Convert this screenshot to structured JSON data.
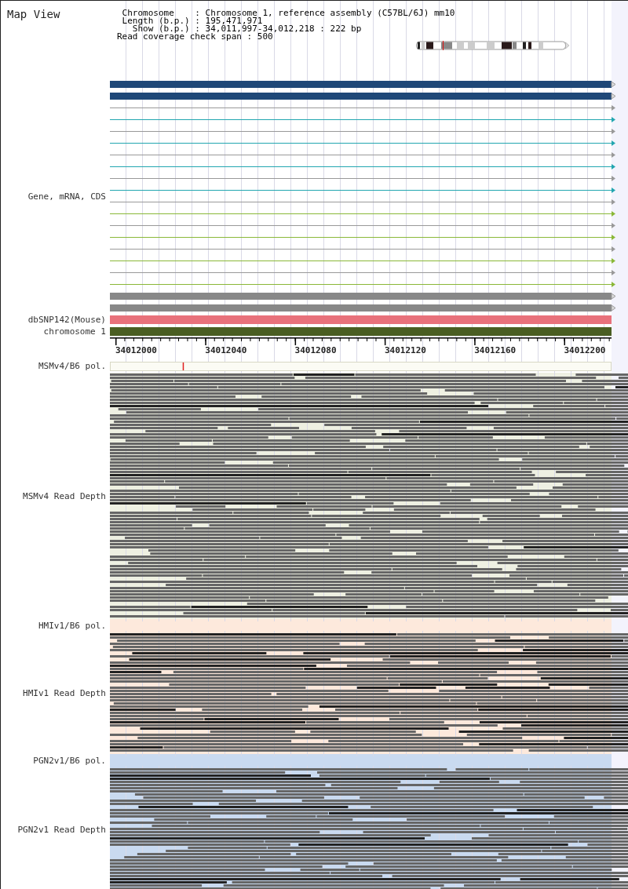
{
  "title": "Map View",
  "info_lines": [
    " Chromosome    : Chromosome 1, reference assembly (C57BL/6J) mm10",
    " Length (b.p.) : 195,471,971",
    "   Show (b.p.) : 34,011,997-34,012,218 : 222 bp",
    "Read coverage check span : 500"
  ],
  "gene_track": {
    "label": "Gene, mRNA, CDS",
    "rows": [
      {
        "kind": "thick",
        "color": "#1f4878"
      },
      {
        "kind": "thick",
        "color": "#1f4878"
      },
      {
        "kind": "thin",
        "color": "#999999"
      },
      {
        "kind": "thin",
        "color": "#22a6b0"
      },
      {
        "kind": "thin",
        "color": "#999999"
      },
      {
        "kind": "thin",
        "color": "#22a6b0"
      },
      {
        "kind": "thin",
        "color": "#999999"
      },
      {
        "kind": "thin",
        "color": "#22a6b0"
      },
      {
        "kind": "thin",
        "color": "#999999"
      },
      {
        "kind": "thin",
        "color": "#22a6b0"
      },
      {
        "kind": "thin",
        "color": "#999999"
      },
      {
        "kind": "thin",
        "color": "#8ab838"
      },
      {
        "kind": "thin",
        "color": "#999999"
      },
      {
        "kind": "thin",
        "color": "#8ab838"
      },
      {
        "kind": "thin",
        "color": "#999999"
      },
      {
        "kind": "thin",
        "color": "#8ab838"
      },
      {
        "kind": "thin",
        "color": "#999999"
      },
      {
        "kind": "thin",
        "color": "#8ab838"
      },
      {
        "kind": "thick",
        "color": "#888888"
      },
      {
        "kind": "thick",
        "color": "#888888"
      }
    ]
  },
  "feature_tracks": [
    {
      "label": "dbSNP142(Mouse)",
      "color": "#e8717b"
    },
    {
      "label": "chromosome 1",
      "color": "#4a5e22"
    }
  ],
  "axis": {
    "ticks": [
      "34012000",
      "34012040",
      "34012080",
      "34012120",
      "34012160",
      "34012200"
    ]
  },
  "sample_tracks": [
    {
      "pol_label": "MSMv4/B6 pol.",
      "depth_label": "MSMv4 Read Depth",
      "color": "#eef0e2",
      "variant_marked": true
    },
    {
      "pol_label": "HMIv1/B6 pol.",
      "depth_label": "HMIv1 Read Depth",
      "color": "#fde9dc",
      "variant_marked": false
    },
    {
      "pol_label": "PGN2v1/B6 pol.",
      "depth_label": "PGN2v1 Read Depth",
      "color": "#c9daf0",
      "variant_marked": false
    }
  ]
}
